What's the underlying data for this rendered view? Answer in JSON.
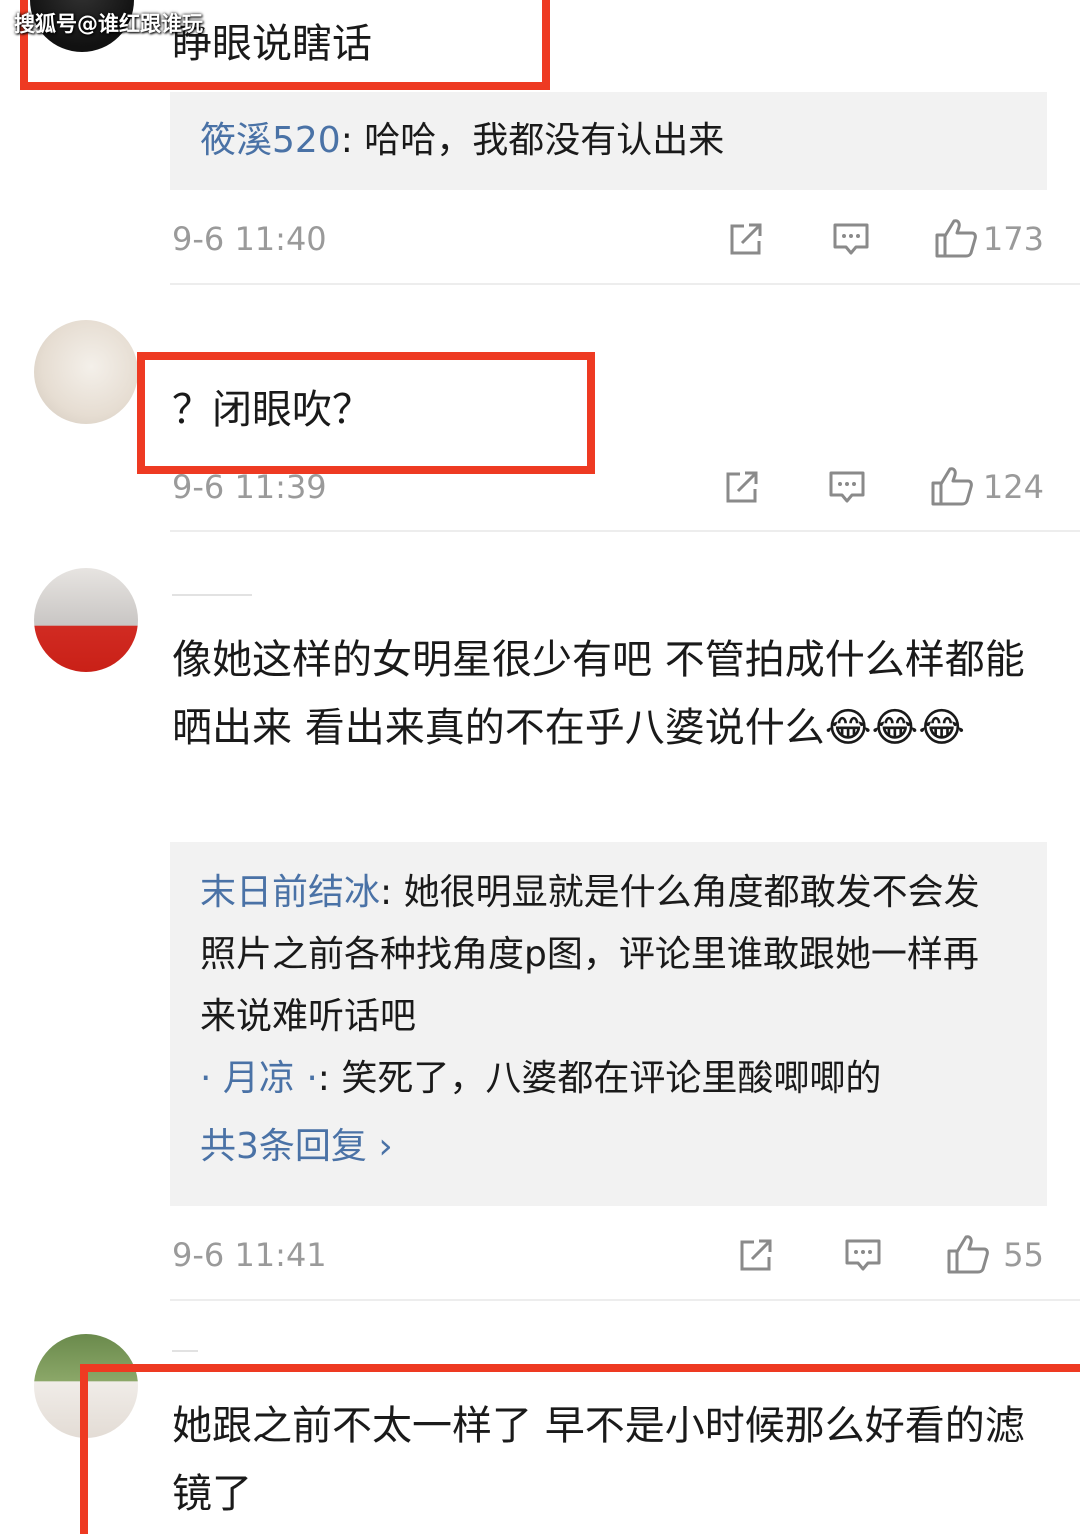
{
  "watermark": "搜狐号@谁红跟谁玩",
  "comments": [
    {
      "text": "睁眼说瞎话",
      "reply": {
        "user": "筱溪520",
        "sep": ": ",
        "text": "哈哈，我都没有认出来"
      },
      "time": "9-6 11:40",
      "likes": "173"
    },
    {
      "text": "？闭眼吹？",
      "time": "9-6 11:39",
      "likes": "124"
    },
    {
      "text": "像她这样的女明星很少有吧 不管拍成什么样都能晒出来 看出来真的不在乎八婆说什么😂😂😂",
      "replies": [
        {
          "user": "末日前结冰",
          "sep": ": ",
          "text": "她很明显就是什么角度都敢发不会发照片之前各种找角度p图，评论里谁敢跟她一样再来说难听话吧"
        },
        {
          "user": "· 月凉 ·",
          "sep": ": ",
          "text": "笑死了，八婆都在评论里酸唧唧的"
        }
      ],
      "more_replies": "共3条回复 ›",
      "time": "9-6 11:41",
      "likes": "55"
    },
    {
      "text": "她跟之前不太一样了  早不是小时候那么好看的滤镜了"
    }
  ],
  "colors": {
    "highlight_box": "#ee3a22",
    "reply_user": "#4a72a6",
    "reply_bg": "#f2f2f2",
    "meta": "#9a9a9a"
  },
  "icons": {
    "share": "share-icon",
    "reply": "comment-icon",
    "like": "thumbs-up-icon"
  }
}
